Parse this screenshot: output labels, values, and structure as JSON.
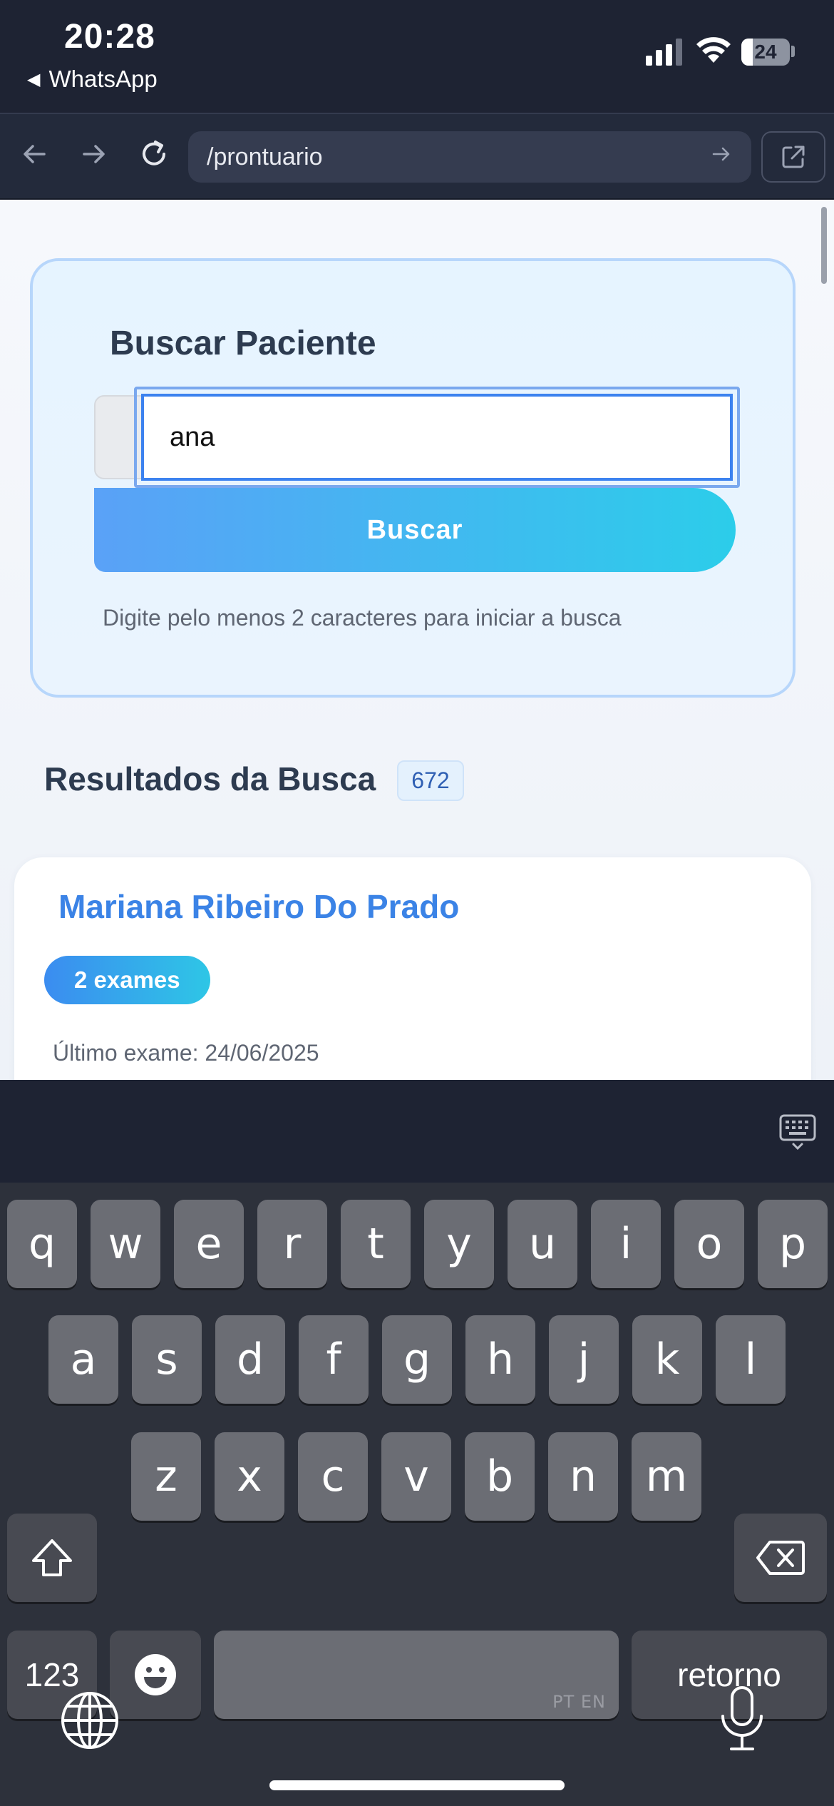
{
  "status_bar": {
    "time": "20:28",
    "back_app": "WhatsApp",
    "battery": "24",
    "battery_level": 0.24,
    "signal_bars": 3
  },
  "browser": {
    "url": "/prontuario"
  },
  "search": {
    "title": "Buscar Paciente",
    "input_value": "ana",
    "button_label": "Buscar",
    "hint": "Digite pelo menos 2 caracteres para iniciar a busca"
  },
  "results": {
    "title": "Resultados da Busca",
    "count": "672",
    "items": [
      {
        "name": "Mariana Ribeiro Do Prado",
        "exams": "2 exames",
        "last_exam": "Último exame: 24/06/2025"
      }
    ]
  },
  "keyboard": {
    "row1": [
      "q",
      "w",
      "e",
      "r",
      "t",
      "y",
      "u",
      "i",
      "o",
      "p"
    ],
    "row2": [
      "a",
      "s",
      "d",
      "f",
      "g",
      "h",
      "j",
      "k",
      "l"
    ],
    "row3": [
      "z",
      "x",
      "c",
      "v",
      "b",
      "n",
      "m"
    ],
    "numbers_key": "123",
    "return_key": "retorno",
    "space_lang": "PT EN"
  },
  "colors": {
    "accent": "#3b83e6",
    "button_gradient_start": "#5aa1f7",
    "button_gradient_end": "#2ccdea"
  }
}
